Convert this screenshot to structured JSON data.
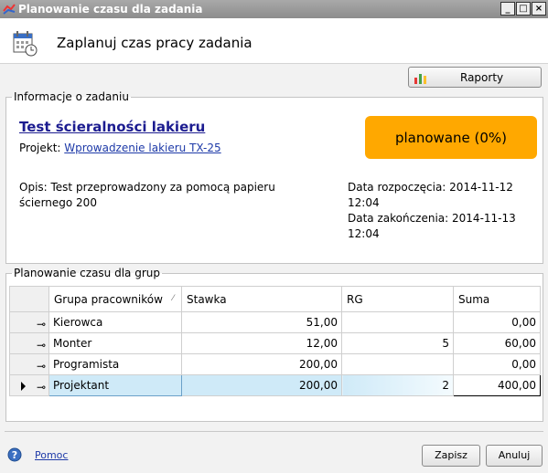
{
  "window": {
    "title": "Planowanie czasu dla zadania"
  },
  "header": {
    "title": "Zaplanuj czas pracy zadania"
  },
  "toolbar": {
    "reports_label": "Raporty"
  },
  "task_info": {
    "legend": "Informacje o zadaniu",
    "name": "Test ścieralności lakieru",
    "project_label": "Projekt:",
    "project_link": "Wprowadzenie lakieru TX-25",
    "status": "planowane (0%)",
    "description_line1": "Opis: Test przeprowadzony za pomocą papieru",
    "description_line2": "ściernego 200",
    "start_label": "Data rozpoczęcia:",
    "start_value": "2014-11-12 12:04",
    "end_label": "Data zakończenia:",
    "end_value": "2014-11-13 12:04",
    "status_color": "#ffa800"
  },
  "planning": {
    "legend": "Planowanie czasu dla grup",
    "columns": [
      "Grupa pracowników",
      "Stawka",
      "RG",
      "Suma"
    ],
    "rows": [
      {
        "group": "Kierowca",
        "rate": "51,00",
        "rg": "",
        "sum": "0,00"
      },
      {
        "group": "Monter",
        "rate": "12,00",
        "rg": "5",
        "sum": "60,00"
      },
      {
        "group": "Programista",
        "rate": "200,00",
        "rg": "",
        "sum": "0,00"
      },
      {
        "group": "Projektant",
        "rate": "200,00",
        "rg": "2",
        "sum": "400,00",
        "selected": true
      }
    ],
    "selection_color": "#cfeaf8"
  },
  "footer": {
    "help_link": "Pomoc",
    "save_label": "Zapisz",
    "cancel_label": "Anuluj"
  },
  "icons": [
    "app-icon",
    "calendar-clock-icon",
    "bar-chart-icon",
    "help-icon",
    "pin-icon",
    "row-pointer-icon",
    "sort-icon"
  ]
}
